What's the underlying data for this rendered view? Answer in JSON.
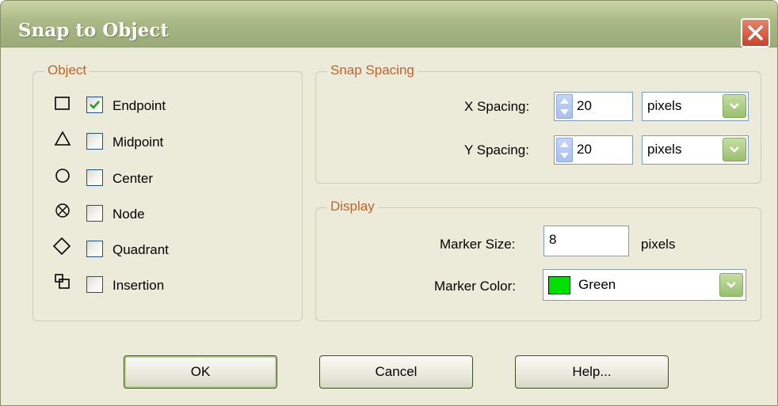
{
  "window": {
    "title": "Snap to Object"
  },
  "object_group": {
    "legend": "Object",
    "items": [
      {
        "label": "Endpoint",
        "checked": true,
        "icon": "square-icon"
      },
      {
        "label": "Midpoint",
        "checked": false,
        "icon": "triangle-icon"
      },
      {
        "label": "Center",
        "checked": false,
        "icon": "circle-icon"
      },
      {
        "label": "Node",
        "checked": false,
        "icon": "crossed-circle-icon"
      },
      {
        "label": "Quadrant",
        "checked": false,
        "icon": "diamond-icon"
      },
      {
        "label": "Insertion",
        "checked": false,
        "icon": "insertion-icon"
      }
    ]
  },
  "snap_spacing": {
    "legend": "Snap Spacing",
    "x": {
      "label": "X Spacing:",
      "value": "20",
      "unit": "pixels"
    },
    "y": {
      "label": "Y Spacing:",
      "value": "20",
      "unit": "pixels"
    }
  },
  "display": {
    "legend": "Display",
    "marker_size": {
      "label": "Marker Size:",
      "value": "8",
      "unit": "pixels"
    },
    "marker_color": {
      "label": "Marker Color:",
      "value": "Green",
      "swatch": "#00e000"
    }
  },
  "buttons": {
    "ok": "OK",
    "cancel": "Cancel",
    "help": "Help..."
  },
  "colors": {
    "accent_legend": "#c0632a",
    "title_bar": "#a9b986",
    "close_red": "#d9553a"
  }
}
